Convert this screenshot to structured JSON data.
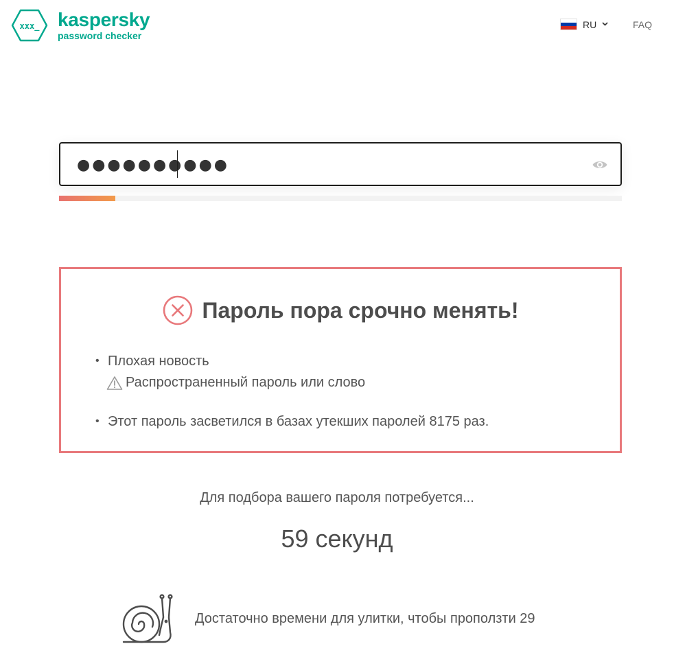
{
  "header": {
    "logo_mark": "xxx_",
    "brand": "kaspersky",
    "product": "password checker",
    "language": {
      "code": "RU",
      "flag_icon": "russia-flag-icon",
      "chevron_icon": "chevron-down-icon"
    },
    "faq_label": "FAQ"
  },
  "password_field": {
    "value": "●●●●●●●●●●",
    "toggle_icon": "eye-icon"
  },
  "strength_meter": {
    "fill_fraction": 0.1,
    "color_start": "#e8726f",
    "color_end": "#f29a4a"
  },
  "verdict": {
    "icon": "error-circle-x-icon",
    "title": "Пароль пора срочно менять!",
    "border_color": "#e8787b",
    "findings": [
      {
        "label": "Плохая новость",
        "detail_icon": "warning-triangle-icon",
        "detail": "Распространенный пароль или слово"
      },
      {
        "label": "Этот пароль засветился в базах утекших паролей 8175 раз."
      }
    ]
  },
  "estimate": {
    "label": "Для подбора вашего пароля потребуется...",
    "value": "59 секунд"
  },
  "comparison": {
    "icon": "snail-icon",
    "text": "Достаточно времени для улитки, чтобы проползти 29"
  },
  "colors": {
    "brand": "#00a88e",
    "alert": "#e8787b",
    "text": "#4d4d4d"
  }
}
